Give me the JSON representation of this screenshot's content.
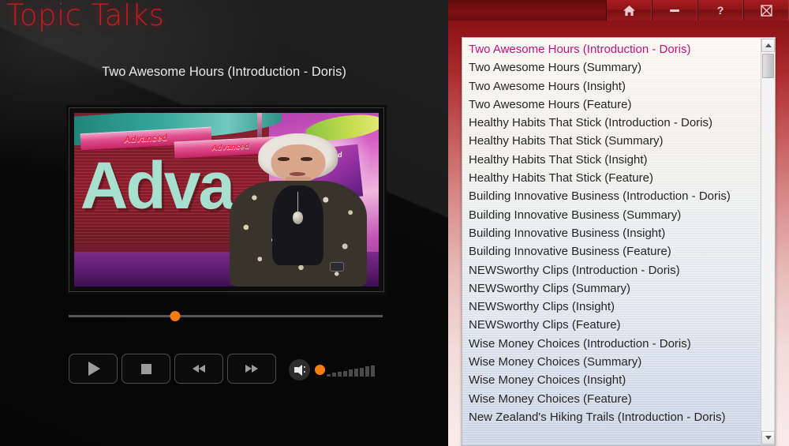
{
  "app": {
    "title": "Topic Talks",
    "title_color": "#c21b22"
  },
  "player": {
    "now_playing_title": "Two Awesome Hours (Introduction - Doris)",
    "seek": {
      "position_percent": 34,
      "knob_color": "#f57c13"
    },
    "volume": {
      "level_percent": 8,
      "knob_color": "#f57c13",
      "steps": 9
    },
    "controls": [
      {
        "name": "play",
        "label": "Play"
      },
      {
        "name": "stop",
        "label": "Stop"
      },
      {
        "name": "rewind",
        "label": "Rewind"
      },
      {
        "name": "fast-forward",
        "label": "Fast Forward"
      }
    ],
    "video": {
      "banner_text_1": "Advanced",
      "banner_text_2": "Advanced",
      "big_word": "Adva",
      "card_text": "Advanced"
    }
  },
  "window_buttons": [
    {
      "name": "home",
      "icon": "home-icon",
      "label": "Home"
    },
    {
      "name": "minimize",
      "icon": "minimize-icon",
      "label": "Minimize"
    },
    {
      "name": "help",
      "icon": "help-icon",
      "label": "?"
    },
    {
      "name": "close",
      "icon": "close-icon",
      "label": "Close"
    }
  ],
  "playlist": {
    "selected_index": 0,
    "selected_color": "#c4127c",
    "items": [
      "Two Awesome Hours (Introduction - Doris)",
      "Two Awesome Hours (Summary)",
      "Two Awesome Hours (Insight)",
      "Two Awesome Hours (Feature)",
      "Healthy Habits That Stick (Introduction - Doris)",
      "Healthy Habits That Stick (Summary)",
      "Healthy Habits That Stick (Insight)",
      "Healthy Habits That Stick (Feature)",
      "Building Innovative Business (Introduction - Doris)",
      "Building Innovative Business (Summary)",
      "Building Innovative Business (Insight)",
      "Building Innovative Business (Feature)",
      "NEWSworthy Clips (Introduction - Doris)",
      "NEWSworthy Clips (Summary)",
      "NEWSworthy Clips (Insight)",
      "NEWSworthy Clips (Feature)",
      "Wise Money Choices (Introduction - Doris)",
      "Wise Money Choices (Summary)",
      "Wise Money Choices (Insight)",
      "Wise Money Choices (Feature)",
      "New Zealand's Hiking Trails (Introduction - Doris)"
    ]
  }
}
